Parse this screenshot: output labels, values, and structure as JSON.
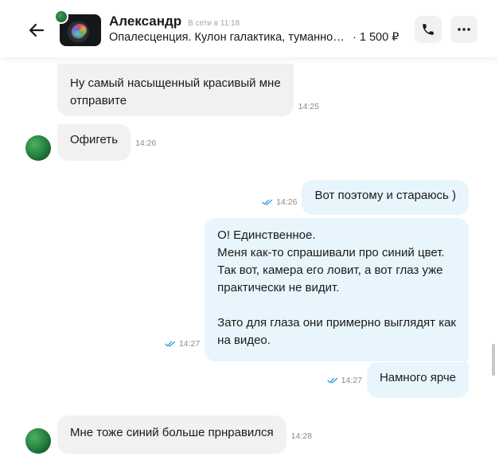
{
  "header": {
    "name": "Александр",
    "status": "В сети в 11:18",
    "listing_title": "Опалесценция. Кулон галактика, туманнос…",
    "listing_price": "· 1 500 ₽"
  },
  "messages": [
    {
      "from": "seller",
      "text": "Ну самый насыщенный красивый мне\nотправите",
      "time": "14:25"
    },
    {
      "from": "seller",
      "text": "Офигеть",
      "time": "14:26"
    },
    {
      "from": "me",
      "text": "Вот поэтому и стараюсь )",
      "time": "14:26",
      "read": true
    },
    {
      "from": "me",
      "text": "О! Единственное.\nМеня как-то спрашивали про синий цвет.\nТак вот, камера его ловит, а вот глаз уже\nпрактически не видит.\n\nЗато для глаза они примерно выглядят как\nна видео.",
      "time": "14:27",
      "read": true
    },
    {
      "from": "me",
      "text": "Намного ярче",
      "time": "14:27",
      "read": true
    },
    {
      "from": "seller",
      "text": "Мне тоже синий больше прнравился",
      "time": "14:28"
    }
  ],
  "colors": {
    "incoming_bubble": "#f2f1f0",
    "outgoing_bubble": "#e8f5fd",
    "read_check": "#2d9cdb"
  }
}
